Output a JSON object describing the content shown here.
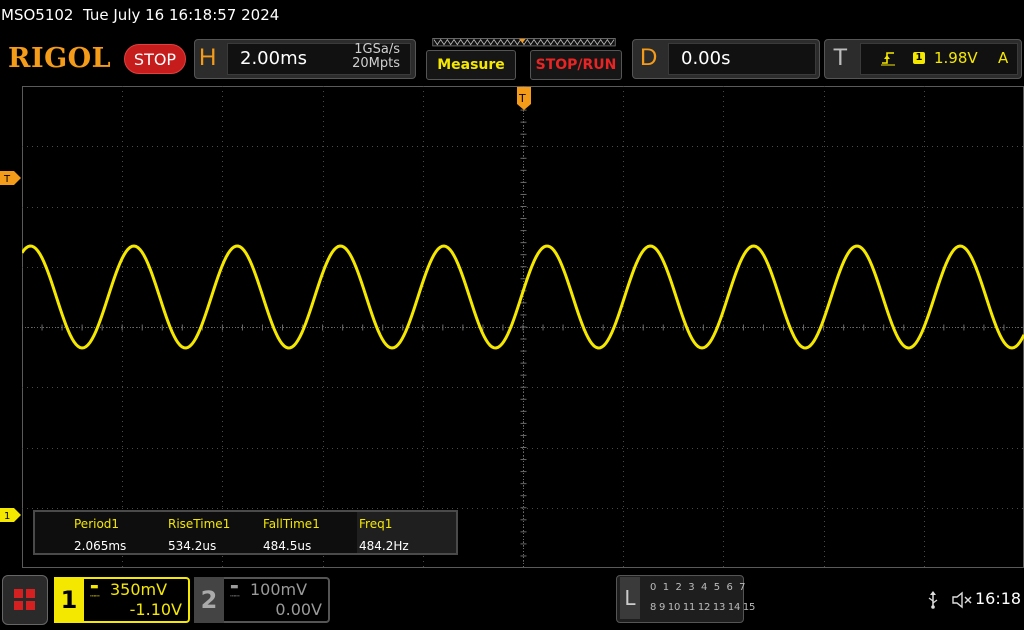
{
  "topline": {
    "model": "MSO5102",
    "datetime": "Tue July 16 16:18:57 2024"
  },
  "header": {
    "logo": "RIGOL",
    "run_state": "STOP",
    "horizontal": {
      "letter": "H",
      "timebase": "2.00ms",
      "sample_rate": "1GSa/s",
      "memory_depth": "20Mpts"
    },
    "measure_label": "Measure",
    "stop_run_label": "STOP/RUN",
    "delay": {
      "letter": "D",
      "value": "0.00s"
    },
    "trigger": {
      "letter": "T",
      "edge_icon": "rising-edge-icon",
      "source": "1",
      "level": "1.98V",
      "mode": "A"
    }
  },
  "screen": {
    "trigger_marker": "T",
    "channel1_marker": "1",
    "time_position_marker": "T"
  },
  "waveform": {
    "channel": "1",
    "color": "#f5e800",
    "shape": "sine",
    "frequency_hz": 484.2,
    "visible_cycles": 9.7
  },
  "measurements": {
    "headers": [
      "Period1",
      "RiseTime1",
      "FallTime1",
      "Freq1"
    ],
    "values": [
      "2.065ms",
      "534.2us",
      "484.5us",
      "484.2Hz"
    ]
  },
  "channels": {
    "ch1": {
      "number": "1",
      "coupling_icon": "dc-coupling-icon",
      "scale": "350mV",
      "offset": "-1.10V",
      "color": "#f5e800"
    },
    "ch2": {
      "number": "2",
      "coupling_icon": "dc-coupling-icon",
      "scale": "100mV",
      "offset": "0.00V",
      "color": "#9a9a9a"
    }
  },
  "logic": {
    "letter": "L",
    "row1": "0 1 2 3  4 5 6 7",
    "row2": "8 9 10 11 12 13 14 15"
  },
  "status": {
    "usb_icon": "usb-icon",
    "sound_icon": "speaker-muted-icon",
    "time": "16:18"
  },
  "colors": {
    "accent_orange": "#f59b1a",
    "ch1_yellow": "#f5e800",
    "stop_red": "#c61c1c"
  }
}
